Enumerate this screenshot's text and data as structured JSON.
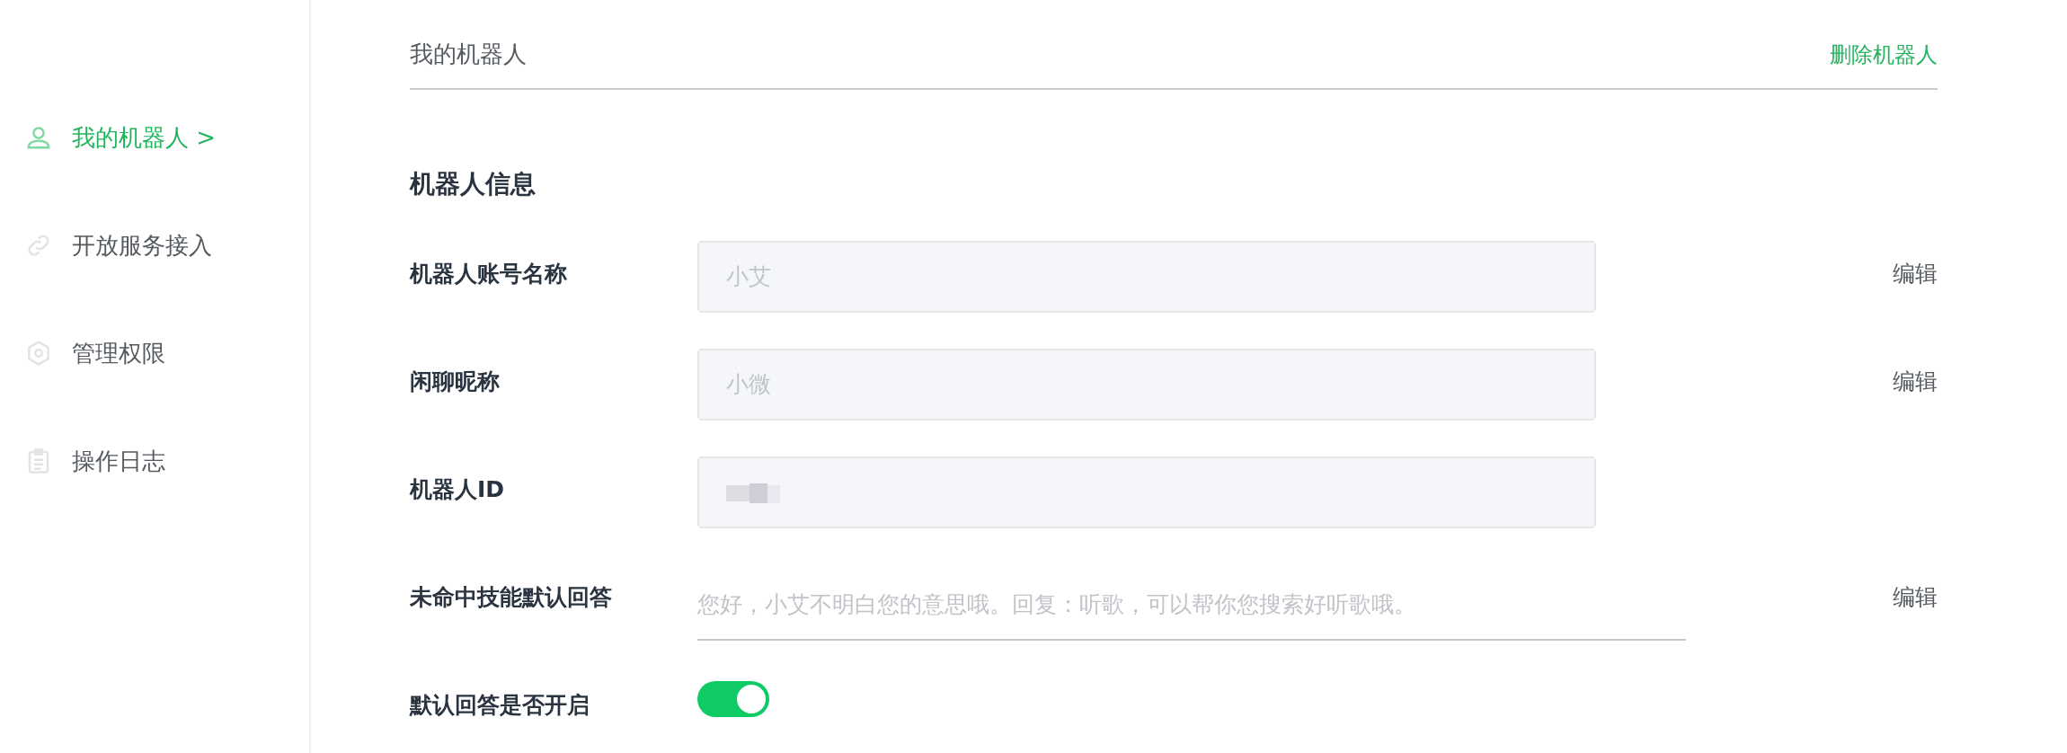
{
  "sidebar": {
    "items": [
      {
        "label": "我的机器人 >",
        "kind": "person",
        "selected": true
      },
      {
        "label": "开放服务接入",
        "kind": "link",
        "selected": false
      },
      {
        "label": "管理权限",
        "kind": "gear",
        "selected": false
      },
      {
        "label": "操作日志",
        "kind": "clipboard",
        "selected": false
      }
    ]
  },
  "header": {
    "title": "我的机器人",
    "action": "删除机器人"
  },
  "section": {
    "title": "机器人信息"
  },
  "fields": [
    {
      "kind": "box",
      "label": "机器人账号名称",
      "value": "小艾",
      "disabled": true,
      "action": "编辑"
    },
    {
      "kind": "box",
      "label": "闲聊昵称",
      "value": "小微",
      "disabled": true,
      "action": "编辑"
    },
    {
      "kind": "box",
      "label": "机器人ID",
      "redacted": true,
      "disabled": true
    },
    {
      "kind": "underline",
      "label": "未命中技能默认回答",
      "value": "您好，小艾不明白您的意思哦。回复：听歌，可以帮你您搜索好听歌哦。",
      "disabled": true,
      "action": "编辑"
    },
    {
      "kind": "toggle",
      "label": "默认回答是否开启",
      "on": true
    }
  ]
}
